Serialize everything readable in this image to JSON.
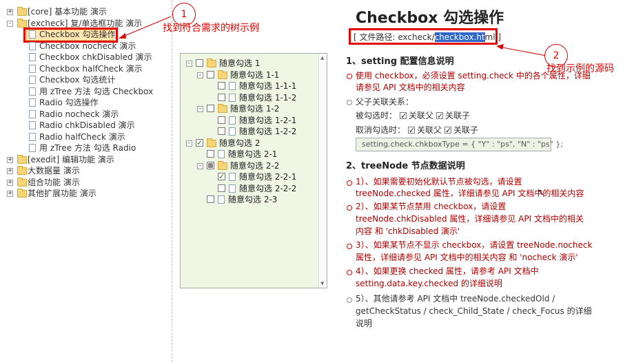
{
  "left_tree": {
    "items": [
      {
        "label": "[core] 基本功能 演示",
        "expander": "+"
      },
      {
        "label": "[excheck] 复/单选框功能 演示",
        "expander": "-"
      },
      {
        "label": "Checkbox 勾选操作"
      },
      {
        "label": "Checkbox nocheck 演示"
      },
      {
        "label": "Checkbox chkDisabled 演示"
      },
      {
        "label": "Checkbox halfCheck 演示"
      },
      {
        "label": "Checkbox 勾选统计"
      },
      {
        "label": "用 zTree 方法 勾选 Checkbox"
      },
      {
        "label": "Radio 勾选操作"
      },
      {
        "label": "Radio nocheck 演示"
      },
      {
        "label": "Radio chkDisabled 演示"
      },
      {
        "label": "Radio halfCheck 演示"
      },
      {
        "label": "用 zTree 方法 勾选 Radio"
      },
      {
        "label": "[exedit] 编辑功能 演示",
        "expander": "+"
      },
      {
        "label": "大数据量 演示",
        "expander": "+"
      },
      {
        "label": "组合功能 演示",
        "expander": "+"
      },
      {
        "label": "其他扩展功能 演示",
        "expander": "+"
      }
    ]
  },
  "annotations": {
    "one": {
      "num": "1",
      "text": "找到符合需求的树示例"
    },
    "two": {
      "num": "2",
      "text": "找到示例的源码"
    }
  },
  "demo_tree": {
    "nodes": [
      {
        "label": "随意勾选 1",
        "expander": "-",
        "check": "none"
      },
      {
        "label": "随意勾选 1-1",
        "expander": "-",
        "check": "none"
      },
      {
        "label": "随意勾选 1-1-1",
        "check": "none"
      },
      {
        "label": "随意勾选 1-1-2",
        "check": "none"
      },
      {
        "label": "随意勾选 1-2",
        "expander": "-",
        "check": "none"
      },
      {
        "label": "随意勾选 1-2-1",
        "check": "none"
      },
      {
        "label": "随意勾选 1-2-2",
        "check": "none"
      },
      {
        "label": "随意勾选 2",
        "expander": "-",
        "check": "checked"
      },
      {
        "label": "随意勾选 2-1",
        "check": "none"
      },
      {
        "label": "随意勾选 2-2",
        "expander": "-",
        "check": "partial"
      },
      {
        "label": "随意勾选 2-2-1",
        "check": "checked"
      },
      {
        "label": "随意勾选 2-2-2",
        "check": "none"
      },
      {
        "label": "随意勾选 2-3",
        "check": "none"
      }
    ]
  },
  "main": {
    "title": "Checkbox 勾选操作",
    "path_prefix": "[ 文件路径: excheck/",
    "path_highlight": "checkbox.ht",
    "path_suffix": "ml ]",
    "s1_title": "1、setting 配置信息说明",
    "s1_line1": "使用 checkbox，必须设置 setting.check 中的各个属性，详细",
    "s1_line2": "请参见 API 文档中的相关内容",
    "s1_rel": "父子关联关系：",
    "s1_checked_label": "被勾选时：",
    "s1_unchecked_label": "取消勾选时：",
    "s1_parent": "关联父",
    "s1_child": "关联子",
    "s1_code": "setting.check.chkboxType = { \"Y\" : \"ps\", \"N\" : \"ps\" };",
    "s2_title": "2、treeNode 节点数据说明",
    "s2_p1a": "1）、如果需要初始化默认节点被勾选，请设置",
    "s2_p1b": "treeNode.checked 属性，详细请参见 API 文档中的相关内容",
    "s2_p2a": "2）、如果某节点禁用 checkbox，请设置",
    "s2_p2b": "treeNode.chkDisabled 属性，详细请参见 API 文档中的相关",
    "s2_p2c": "内容 和 'chkDisabled 演示'",
    "s2_p3a": "3）、如果某节点不显示 checkbox，请设置 treeNode.nocheck",
    "s2_p3b": "属性，详细请参见 API 文档中的相关内容 和 'nocheck 演示'",
    "s2_p4a": "4）、如果更换 checked 属性，请参考 API 文档中",
    "s2_p4b": "setting.data.key.checked 的详细说明",
    "s2_p5a": "5）、其他请参考 API 文档中 treeNode.checkedOld /",
    "s2_p5b": "getCheckStatus / check_Child_State / check_Focus 的详细",
    "s2_p5c": "说明"
  }
}
